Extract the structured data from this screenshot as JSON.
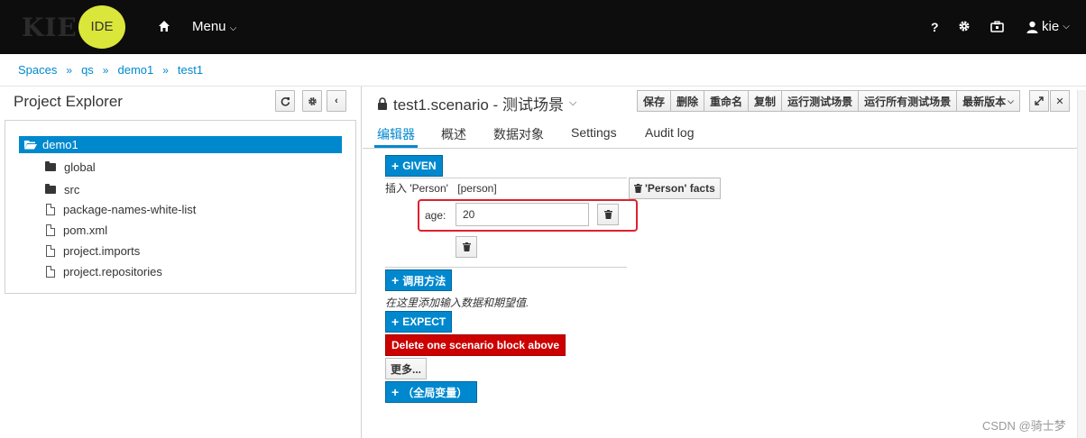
{
  "topnav": {
    "logo_text": "KIE",
    "logo_badge": "IDE",
    "menu_label": "Menu",
    "help_label": "?",
    "user_label": "kie"
  },
  "breadcrumb": [
    "Spaces",
    "qs",
    "demo1",
    "test1"
  ],
  "project_explorer": {
    "title": "Project Explorer",
    "root": "demo1",
    "folders": [
      "global",
      "src"
    ],
    "files": [
      "package-names-white-list",
      "pom.xml",
      "project.imports",
      "project.repositories"
    ]
  },
  "editor": {
    "title": "test1.scenario - 测试场景",
    "toolbar": [
      "保存",
      "删除",
      "重命名",
      "复制",
      "运行测试场景",
      "运行所有测试场景",
      "最新版本"
    ],
    "tabs": [
      "编辑器",
      "概述",
      "数据对象",
      "Settings",
      "Audit log"
    ],
    "active_tab": "编辑器"
  },
  "scenario": {
    "given_label": "GIVEN",
    "insert_label": "插入 'Person'",
    "insert_var": "[person]",
    "facts_button": "'Person' facts",
    "field_label": "age:",
    "field_value": "20",
    "call_method_label": "调用方法",
    "hint": "在这里添加输入数据和期望值.",
    "expect_label": "EXPECT",
    "delete_block_label": "Delete one scenario block above",
    "more_label": "更多...",
    "globals_label": "（全局变量）"
  },
  "watermark": "CSDN @骑士梦",
  "colors": {
    "accent": "#0088ce",
    "danger": "#cc0000",
    "nav_bg": "#0d0d0d",
    "logo_badge": "#dbe63a"
  }
}
